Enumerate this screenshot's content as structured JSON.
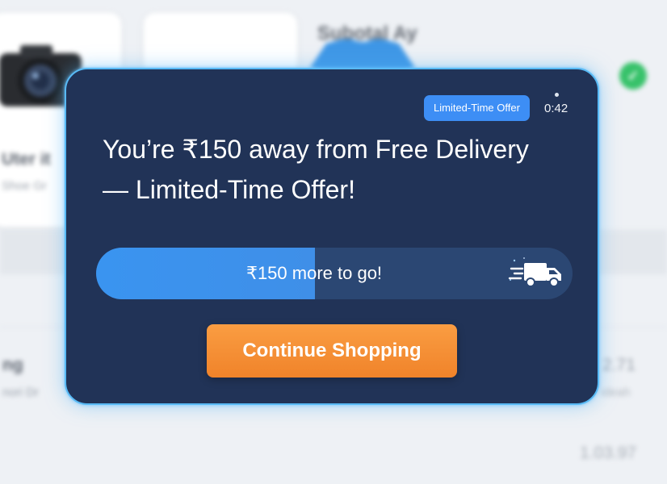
{
  "background": {
    "subtotal_label": "Subotal Ay",
    "left_item_title": "Uter it",
    "left_item_sub": "Shoe Gr",
    "row_title": "ng",
    "row_sub": "nori Dr",
    "row_value": "2.71",
    "row_value_sub": "ideah",
    "total_value": "1.03.97"
  },
  "offer_modal": {
    "badge": "Limited-Time Offer",
    "timer": "0:42",
    "headline": "You’re ₹150 away from Free Delivery — Limited-Time Offer!",
    "progress": {
      "label": "₹150 more to go!",
      "fraction": 0.46
    },
    "cta_label": "Continue Shopping",
    "icons": [
      "delivery-truck-icon"
    ]
  },
  "colors": {
    "modal_bg": "#213357",
    "modal_border": "#58baf5",
    "accent_blue": "#3d8ef5",
    "cta_orange": "#f58a30"
  }
}
